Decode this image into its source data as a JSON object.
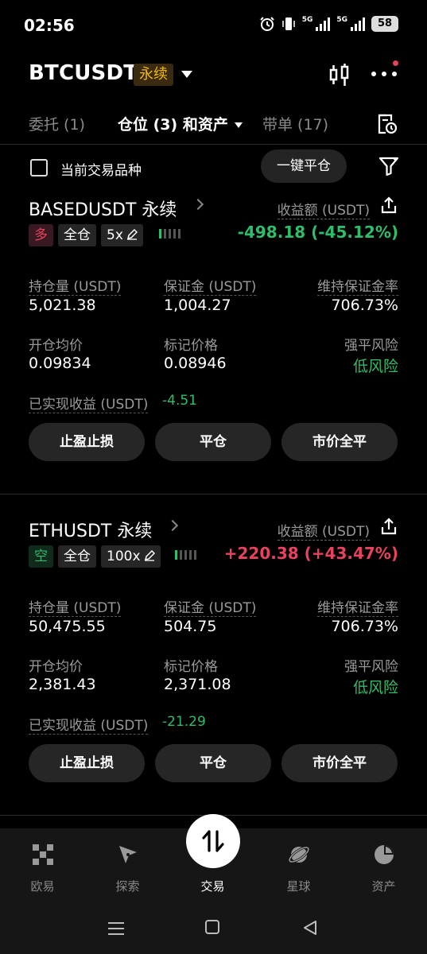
{
  "status_bar": {
    "time": "02:56",
    "net1": "5G",
    "net2": "5G",
    "battery": "58"
  },
  "header": {
    "symbol": "BTCUSDT",
    "badge": "永续"
  },
  "tabs": [
    {
      "label": "委托 (1)"
    },
    {
      "label": "仓位 (3) 和资产"
    },
    {
      "label": "带单 (17)"
    }
  ],
  "filter": {
    "label": "当前交易品种",
    "close_all": "一键平仓"
  },
  "positions": [
    {
      "pair": "BASEDUSDT 永续",
      "pnl_label": "收益额 (USDT)",
      "side": "多",
      "side_type": "long",
      "margin_mode": "全仓",
      "leverage": "5x",
      "pnl": "-498.18 (-45.12%)",
      "size_label": "持仓量 (USDT)",
      "size": "5,021.38",
      "margin_label": "保证金 (USDT)",
      "margin": "1,004.27",
      "mmr_label": "维持保证金率",
      "mmr": "706.73%",
      "entry_label": "开仓均价",
      "entry": "0.09834",
      "mark_label": "标记价格",
      "mark": "0.08946",
      "risk_label": "强平风险",
      "risk": "低风险",
      "realized_label": "已实现收益 (USDT)",
      "realized": "-4.51",
      "btn_tpsl": "止盈止损",
      "btn_close": "平仓",
      "btn_market_close": "市价全平",
      "risk_level": 0.2
    },
    {
      "pair": "ETHUSDT 永续",
      "pnl_label": "收益额 (USDT)",
      "side": "空",
      "side_type": "short",
      "margin_mode": "全仓",
      "leverage": "100x",
      "pnl": "+220.38 (+43.47%)",
      "size_label": "持仓量 (USDT)",
      "size": "50,475.55",
      "margin_label": "保证金 (USDT)",
      "margin": "504.75",
      "mmr_label": "维持保证金率",
      "mmr": "706.73%",
      "entry_label": "开仓均价",
      "entry": "2,381.43",
      "mark_label": "标记价格",
      "mark": "2,371.08",
      "risk_label": "强平风险",
      "risk": "低风险",
      "realized_label": "已实现收益 (USDT)",
      "realized": "-21.29",
      "btn_tpsl": "止盈止损",
      "btn_close": "平仓",
      "btn_market_close": "市价全平",
      "risk_level": 0.2
    }
  ],
  "bottom_nav": [
    {
      "label": "欧易",
      "icon": "okx-logo-icon"
    },
    {
      "label": "探索",
      "icon": "compass-icon"
    },
    {
      "label": "交易",
      "icon": "trade-swap-icon",
      "active": true
    },
    {
      "label": "星球",
      "icon": "planet-icon"
    },
    {
      "label": "资产",
      "icon": "pie-chart-icon"
    }
  ],
  "colors": {
    "up": "#2ebd6b",
    "down": "#e8425f",
    "accent": "#f0b90b"
  }
}
